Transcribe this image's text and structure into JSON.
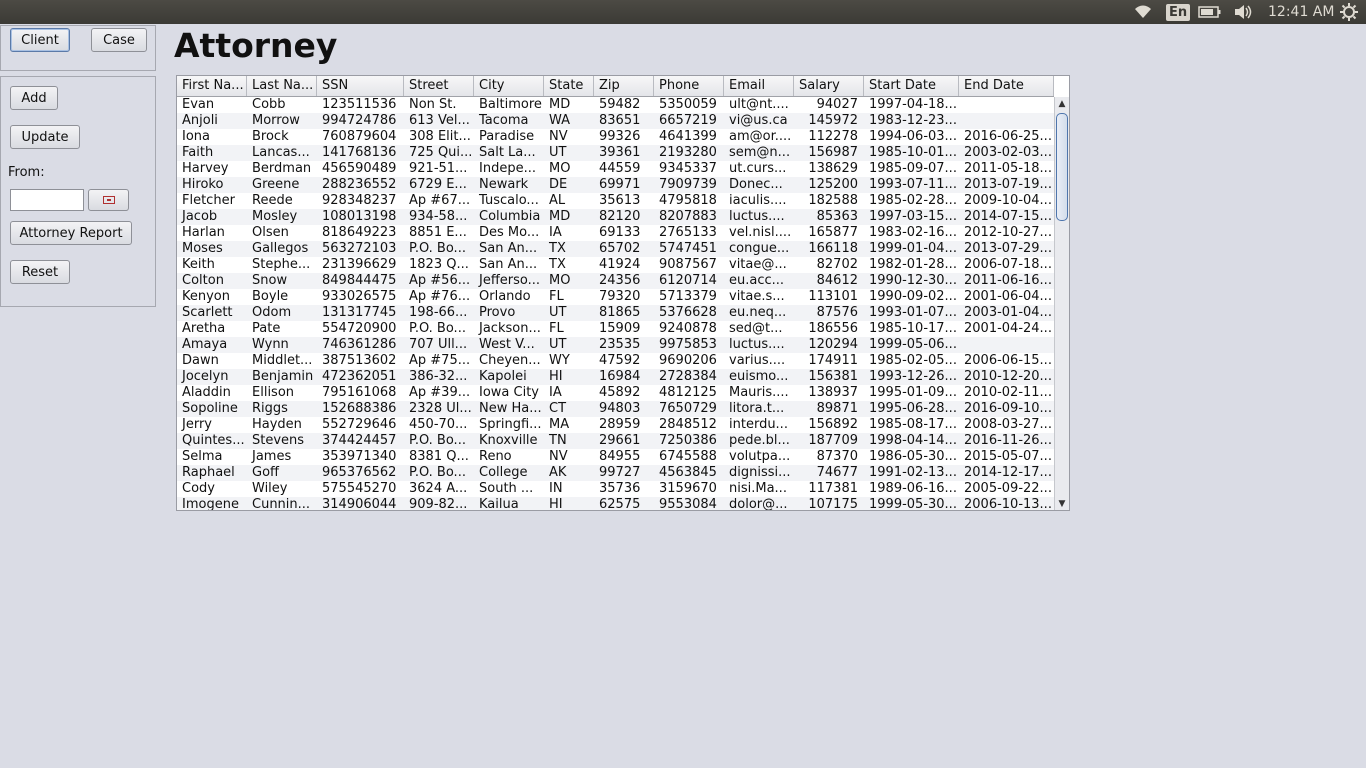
{
  "system_bar": {
    "language": "En",
    "time": "12:41 AM"
  },
  "nav": {
    "client_label": "Client",
    "case_label": "Case"
  },
  "actions": {
    "add_label": "Add",
    "update_label": "Update",
    "from_label": "From:",
    "from_value": "",
    "report_label": "Attorney Report",
    "reset_label": "Reset"
  },
  "page": {
    "title": "Attorney"
  },
  "table": {
    "columns": [
      "First Na...",
      "Last Na...",
      "SSN",
      "Street",
      "City",
      "State",
      "Zip",
      "Phone",
      "Email",
      "Salary",
      "Start Date",
      "End Date"
    ],
    "rows": [
      [
        "Evan",
        "Cobb",
        "123511536",
        "Non St.",
        "Baltimore",
        "MD",
        "59482",
        "5350059",
        "ult@nt....",
        "94027",
        "1997-04-18...",
        ""
      ],
      [
        "Anjoli",
        "Morrow",
        "994724786",
        "613 Vel...",
        "Tacoma",
        "WA",
        "83651",
        "6657219",
        "vi@us.ca",
        "145972",
        "1983-12-23...",
        ""
      ],
      [
        "Iona",
        "Brock",
        "760879604",
        "308 Elit...",
        "Paradise",
        "NV",
        "99326",
        "4641399",
        "am@or....",
        "112278",
        "1994-06-03...",
        "2016-06-25..."
      ],
      [
        "Faith",
        "Lancas...",
        "141768136",
        "725 Qui...",
        "Salt La...",
        "UT",
        "39361",
        "2193280",
        "sem@n...",
        "156987",
        "1985-10-01...",
        "2003-02-03..."
      ],
      [
        "Harvey",
        "Berdman",
        "456590489",
        "921-51...",
        "Indepe...",
        "MO",
        "44559",
        "9345337",
        "ut.curs...",
        "138629",
        "1985-09-07...",
        "2011-05-18..."
      ],
      [
        "Hiroko",
        "Greene",
        "288236552",
        "6729 E...",
        "Newark",
        "DE",
        "69971",
        "7909739",
        "Donec...",
        "125200",
        "1993-07-11...",
        "2013-07-19..."
      ],
      [
        "Fletcher",
        "Reede",
        "928348237",
        "Ap #67...",
        "Tuscalo...",
        "AL",
        "35613",
        "4795818",
        "iaculis....",
        "182588",
        "1985-02-28...",
        "2009-10-04..."
      ],
      [
        "Jacob",
        "Mosley",
        "108013198",
        "934-58...",
        "Columbia",
        "MD",
        "82120",
        "8207883",
        "luctus....",
        "85363",
        "1997-03-15...",
        "2014-07-15..."
      ],
      [
        "Harlan",
        "Olsen",
        "818649223",
        "8851 E...",
        "Des Mo...",
        "IA",
        "69133",
        "2765133",
        "vel.nisl....",
        "165877",
        "1983-02-16...",
        "2012-10-27..."
      ],
      [
        "Moses",
        "Gallegos",
        "563272103",
        "P.O. Bo...",
        "San An...",
        "TX",
        "65702",
        "5747451",
        "congue...",
        "166118",
        "1999-01-04...",
        "2013-07-29..."
      ],
      [
        "Keith",
        "Stephe...",
        "231396629",
        "1823 Q...",
        "San An...",
        "TX",
        "41924",
        "9087567",
        "vitae@...",
        "82702",
        "1982-01-28...",
        "2006-07-18..."
      ],
      [
        "Colton",
        "Snow",
        "849844475",
        "Ap #56...",
        "Jefferso...",
        "MO",
        "24356",
        "6120714",
        "eu.acc...",
        "84612",
        "1990-12-30...",
        "2011-06-16..."
      ],
      [
        "Kenyon",
        "Boyle",
        "933026575",
        "Ap #76...",
        "Orlando",
        "FL",
        "79320",
        "5713379",
        "vitae.s...",
        "113101",
        "1990-09-02...",
        "2001-06-04..."
      ],
      [
        "Scarlett",
        "Odom",
        "131317745",
        "198-66...",
        "Provo",
        "UT",
        "81865",
        "5376628",
        "eu.neq...",
        "87576",
        "1993-01-07...",
        "2003-01-04..."
      ],
      [
        "Aretha",
        "Pate",
        "554720900",
        "P.O. Bo...",
        "Jackson...",
        "FL",
        "15909",
        "9240878",
        "sed@t...",
        "186556",
        "1985-10-17...",
        "2001-04-24..."
      ],
      [
        "Amaya",
        "Wynn",
        "746361286",
        "707 Ull...",
        "West V...",
        "UT",
        "23535",
        "9975853",
        "luctus....",
        "120294",
        "1999-05-06...",
        ""
      ],
      [
        "Dawn",
        "Middlet...",
        "387513602",
        "Ap #75...",
        "Cheyen...",
        "WY",
        "47592",
        "9690206",
        "varius....",
        "174911",
        "1985-02-05...",
        "2006-06-15..."
      ],
      [
        "Jocelyn",
        "Benjamin",
        "472362051",
        "386-32...",
        "Kapolei",
        "HI",
        "16984",
        "2728384",
        "euismo...",
        "156381",
        "1993-12-26...",
        "2010-12-20..."
      ],
      [
        "Aladdin",
        "Ellison",
        "795161068",
        "Ap #39...",
        "Iowa City",
        "IA",
        "45892",
        "4812125",
        "Mauris....",
        "138937",
        "1995-01-09...",
        "2010-02-11..."
      ],
      [
        "Sopoline",
        "Riggs",
        "152688386",
        "2328 Ul...",
        "New Ha...",
        "CT",
        "94803",
        "7650729",
        "litora.t...",
        "89871",
        "1995-06-28...",
        "2016-09-10..."
      ],
      [
        "Jerry",
        "Hayden",
        "552729646",
        "450-70...",
        "Springfi...",
        "MA",
        "28959",
        "2848512",
        "interdu...",
        "156892",
        "1985-08-17...",
        "2008-03-27..."
      ],
      [
        "Quintes...",
        "Stevens",
        "374424457",
        "P.O. Bo...",
        "Knoxville",
        "TN",
        "29661",
        "7250386",
        "pede.bl...",
        "187709",
        "1998-04-14...",
        "2016-11-26..."
      ],
      [
        "Selma",
        "James",
        "353971340",
        "8381 Q...",
        "Reno",
        "NV",
        "84955",
        "6745588",
        "volutpa...",
        "87370",
        "1986-05-30...",
        "2015-05-07..."
      ],
      [
        "Raphael",
        "Goff",
        "965376562",
        "P.O. Bo...",
        "College",
        "AK",
        "99727",
        "4563845",
        "dignissi...",
        "74677",
        "1991-02-13...",
        "2014-12-17..."
      ],
      [
        "Cody",
        "Wiley",
        "575545270",
        "3624 A...",
        "South ...",
        "IN",
        "35736",
        "3159670",
        "nisi.Ma...",
        "117381",
        "1989-06-16...",
        "2005-09-22..."
      ],
      [
        "Imogene",
        "Cunnin...",
        "314906044",
        "909-82...",
        "Kailua",
        "HI",
        "62575",
        "9553084",
        "dolor@...",
        "107175",
        "1999-05-30...",
        "2006-10-13..."
      ]
    ]
  }
}
